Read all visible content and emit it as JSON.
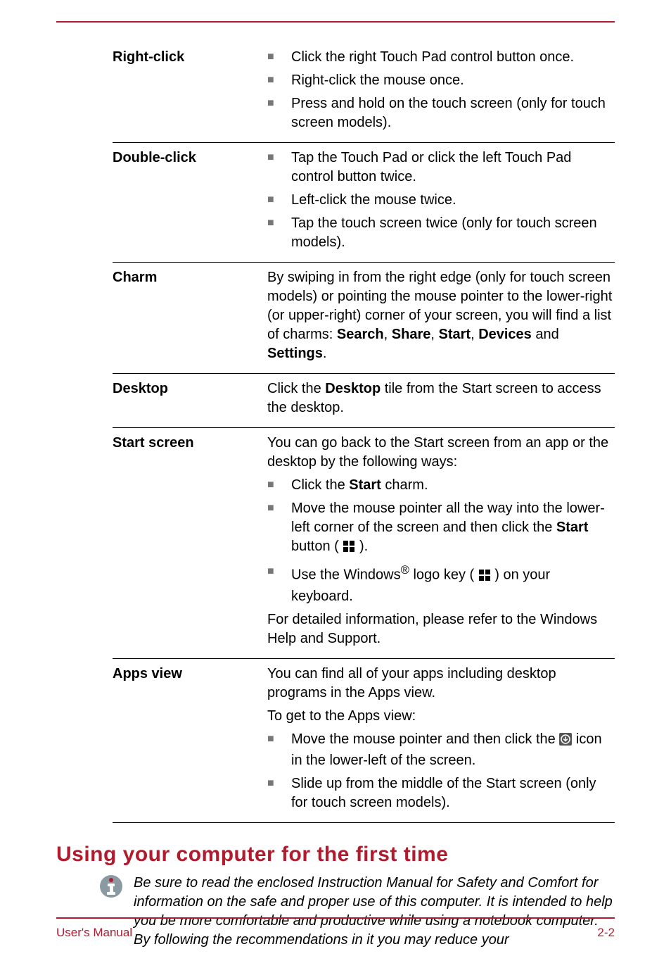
{
  "rows": [
    {
      "term": "Right-click",
      "bullets": [
        "Click the right Touch Pad control button once.",
        "Right-click the mouse once.",
        "Press and hold on the touch screen (only for touch screen models)."
      ]
    },
    {
      "term": "Double-click",
      "bullets": [
        "Tap the Touch Pad or click the left Touch Pad control button twice.",
        "Left-click the mouse twice.",
        "Tap the touch screen twice (only for touch screen models)."
      ]
    },
    {
      "term": "Charm",
      "para_parts": {
        "pre": "By swiping in from the right edge (only for touch screen models) or pointing the mouse pointer to the lower-right (or upper-right) corner of your screen, you will find a list of charms: ",
        "bold1": "Search",
        "mid1": ", ",
        "bold2": "Share",
        "mid2": ", ",
        "bold3": "Start",
        "mid3": ", ",
        "bold4": "Devices",
        "mid4": " and ",
        "bold5": "Settings",
        "post": "."
      }
    },
    {
      "term": "Desktop",
      "para_parts": {
        "pre": "Click the ",
        "bold": "Desktop",
        "post": " tile from the Start screen to access the desktop."
      }
    },
    {
      "term": "Start screen",
      "intro": "You can go back to the Start screen from an app or the desktop by the following ways:",
      "bullets_special": [
        {
          "parts": [
            {
              "text": "Click the "
            },
            {
              "bold": "Start"
            },
            {
              "text": " charm."
            }
          ]
        },
        {
          "parts": [
            {
              "text": "Move the mouse pointer all the way into the lower-left corner of the screen and then click the "
            },
            {
              "bold": "Start"
            },
            {
              "text": " button ( "
            },
            {
              "icon": "winlogo"
            },
            {
              "text": " )."
            }
          ]
        },
        {
          "parts": [
            {
              "text": "Use the Windows"
            },
            {
              "sup": "®"
            },
            {
              "text": " logo key ( "
            },
            {
              "icon": "winlogo"
            },
            {
              "text": " ) on your keyboard."
            }
          ]
        }
      ],
      "outro": "For detailed information, please refer to the Windows Help and Support."
    },
    {
      "term": "Apps view",
      "intro": "You can find all of your apps including desktop programs in the Apps view.",
      "intro2": "To get to the Apps view:",
      "bullets_special": [
        {
          "parts": [
            {
              "text": "Move the mouse pointer and then click the "
            },
            {
              "icon": "downarrow"
            },
            {
              "text": " icon in the lower-left of the screen."
            }
          ]
        },
        {
          "parts": [
            {
              "text": "Slide up from the middle of the Start screen (only for touch screen models)."
            }
          ]
        }
      ]
    }
  ],
  "heading": "Using your computer for the first time",
  "note": "Be sure to read the enclosed Instruction Manual for Safety and Comfort for information on the safe and proper use of this computer. It is intended to help you be more comfortable and productive while using a notebook computer. By following the recommendations in it you may reduce your",
  "footer": {
    "left": "User's Manual",
    "right": "2-2"
  },
  "icons": {
    "square": "■"
  }
}
